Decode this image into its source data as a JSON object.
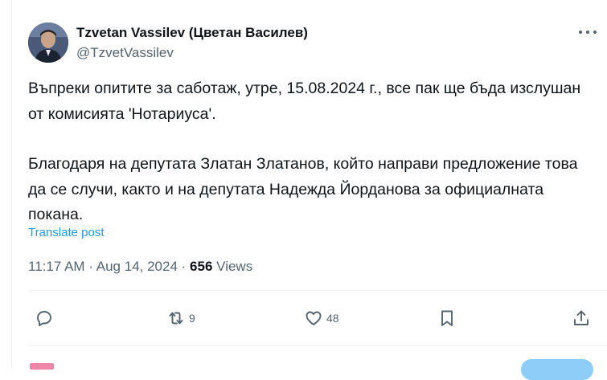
{
  "author": {
    "name": "Tzvetan Vassilev (Цветан Василев)",
    "handle": "@TzvetVassilev",
    "avatar": "avatar-photo"
  },
  "tweet": {
    "paragraphs": [
      "Въпреки опитите за саботаж, утре, 15.08.2024 г., все пак ще бъда изслушан от комисията 'Нотариуса'.",
      "Благодаря на депутата Златан Златанов, който направи предложение това да се случи, както и на депутата Надежда Йорданова за официалната покана."
    ],
    "translate_label": "Translate post"
  },
  "meta": {
    "time": "11:17 AM",
    "separator": "·",
    "date": "Aug 14, 2024",
    "views_count": "656",
    "views_label": "Views"
  },
  "actions": {
    "reply": {
      "icon": "reply-icon",
      "count": ""
    },
    "retweet": {
      "icon": "retweet-icon",
      "count": "9"
    },
    "like": {
      "icon": "heart-icon",
      "count": "48"
    },
    "bookmark": {
      "icon": "bookmark-icon",
      "count": ""
    },
    "share": {
      "icon": "share-icon",
      "count": ""
    }
  },
  "colors": {
    "link": "#1d9bf0",
    "secondary_text": "#536471",
    "primary_text": "#0f1419"
  }
}
